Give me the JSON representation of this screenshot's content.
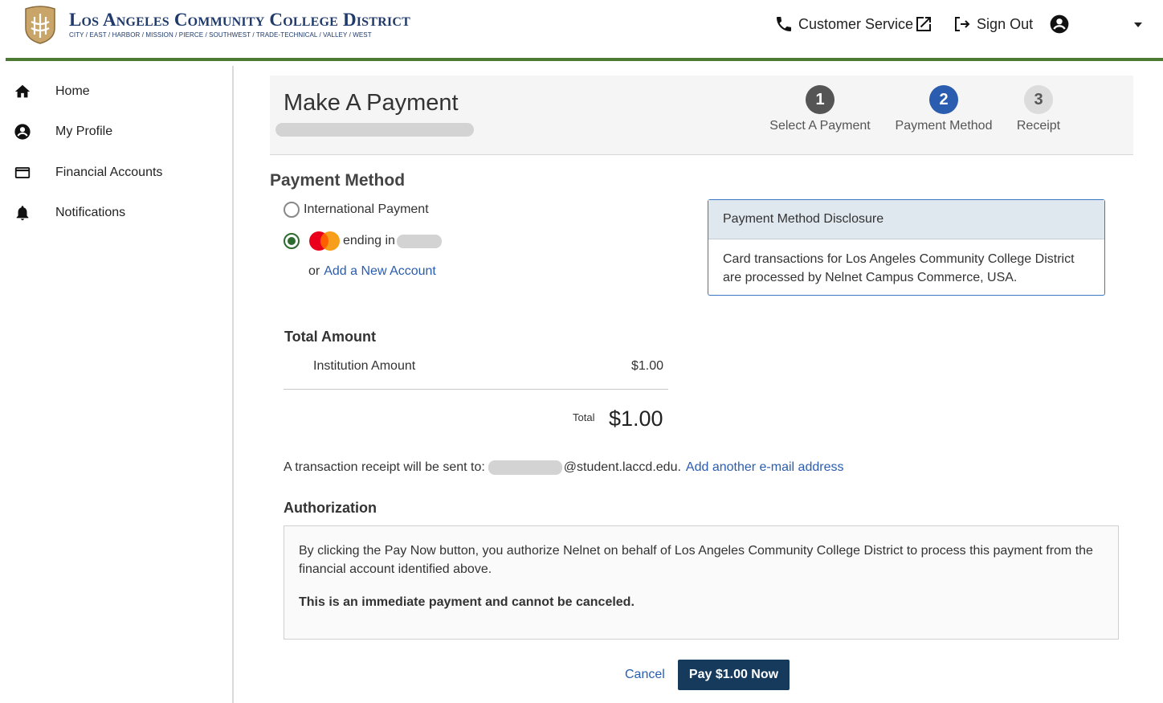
{
  "header": {
    "brand_title": "Los Angeles Community College District",
    "brand_subtitle": "CITY / EAST / HARBOR / MISSION / PIERCE / SOUTHWEST / TRADE-TECHNICAL / VALLEY / WEST",
    "customer_service": "Customer Service",
    "sign_out": "Sign Out"
  },
  "sidebar": {
    "items": [
      {
        "label": "Home",
        "icon": "home-icon"
      },
      {
        "label": "My Profile",
        "icon": "account-circle-icon"
      },
      {
        "label": "Financial Accounts",
        "icon": "credit-card-icon"
      },
      {
        "label": "Notifications",
        "icon": "bell-icon"
      }
    ]
  },
  "page": {
    "title": "Make A Payment",
    "steps": [
      {
        "number": "1",
        "label": "Select A Payment",
        "color": "#555555"
      },
      {
        "number": "2",
        "label": "Payment Method",
        "color": "#2a5db0"
      },
      {
        "number": "3",
        "label": "Receipt",
        "color": "#d8d8d8"
      }
    ]
  },
  "payment_method": {
    "heading": "Payment Method",
    "option_international": "International Payment",
    "option_card": "ending in",
    "or_text": "or",
    "add_account": "Add a New Account",
    "selected": "card"
  },
  "disclosure": {
    "title": "Payment Method Disclosure",
    "body": "Card transactions for Los Angeles Community College District are processed by Nelnet Campus Commerce, USA."
  },
  "amount": {
    "heading": "Total Amount",
    "institution_label": "Institution Amount",
    "institution_value": "$1.00",
    "total_label": "Total",
    "total_value": "$1.00"
  },
  "receipt": {
    "prefix": "A transaction receipt will be sent to:",
    "email_domain": "@student.laccd.edu.",
    "add_email": "Add another e-mail address"
  },
  "authorization": {
    "heading": "Authorization",
    "text": "By clicking the Pay Now button, you authorize Nelnet on behalf of Los Angeles Community College District to process this payment from the financial account identified above.",
    "warning": "This is an immediate payment and cannot be canceled."
  },
  "actions": {
    "cancel": "Cancel",
    "pay": "Pay $1.00 Now"
  },
  "colors": {
    "brand": "#1f3a6b",
    "header_rule": "#4d7a33",
    "link": "#2a5db0",
    "pay_button": "#153a5c",
    "radio_selected": "#2e6b2e"
  }
}
